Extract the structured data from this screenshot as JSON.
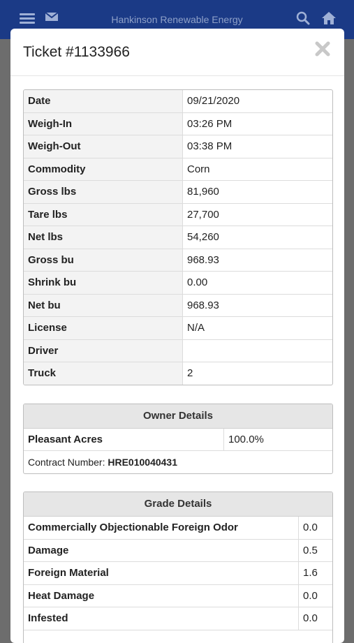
{
  "app_bar": {
    "title": "Hankinson Renewable Energy",
    "icons": [
      "menu-icon",
      "mail-icon",
      "search-icon",
      "home-icon"
    ]
  },
  "modal": {
    "title": "Ticket #1133966",
    "close_icon": "close-icon"
  },
  "ticket_fields": [
    {
      "label": "Date",
      "value": "09/21/2020"
    },
    {
      "label": "Weigh-In",
      "value": "03:26 PM"
    },
    {
      "label": "Weigh-Out",
      "value": "03:38 PM"
    },
    {
      "label": "Commodity",
      "value": "Corn"
    },
    {
      "label": "Gross lbs",
      "value": "81,960"
    },
    {
      "label": "Tare lbs",
      "value": "27,700"
    },
    {
      "label": "Net lbs",
      "value": "54,260"
    },
    {
      "label": "Gross bu",
      "value": "968.93"
    },
    {
      "label": "Shrink bu",
      "value": "0.00"
    },
    {
      "label": "Net bu",
      "value": "968.93"
    },
    {
      "label": "License",
      "value": "N/A"
    },
    {
      "label": "Driver",
      "value": ""
    },
    {
      "label": "Truck",
      "value": "2"
    }
  ],
  "owner_details": {
    "heading": "Owner Details",
    "owner_name": "Pleasant Acres",
    "owner_share": "100.0%",
    "contract_label": "Contract Number:",
    "contract_number": "HRE010040431"
  },
  "grade_details": {
    "heading": "Grade Details",
    "rows": [
      {
        "label": "Commercially Objectionable Foreign Odor",
        "value": "0.0"
      },
      {
        "label": "Damage",
        "value": "0.5"
      },
      {
        "label": "Foreign Material",
        "value": "1.6"
      },
      {
        "label": "Heat Damage",
        "value": "0.0"
      },
      {
        "label": "Infested",
        "value": "0.0"
      }
    ]
  },
  "colors": {
    "app_bar": "#1b3a86",
    "overlay": "#6d6d6d",
    "label_bg": "#f3f3f3",
    "panel_head_bg": "#e6e6e6"
  }
}
